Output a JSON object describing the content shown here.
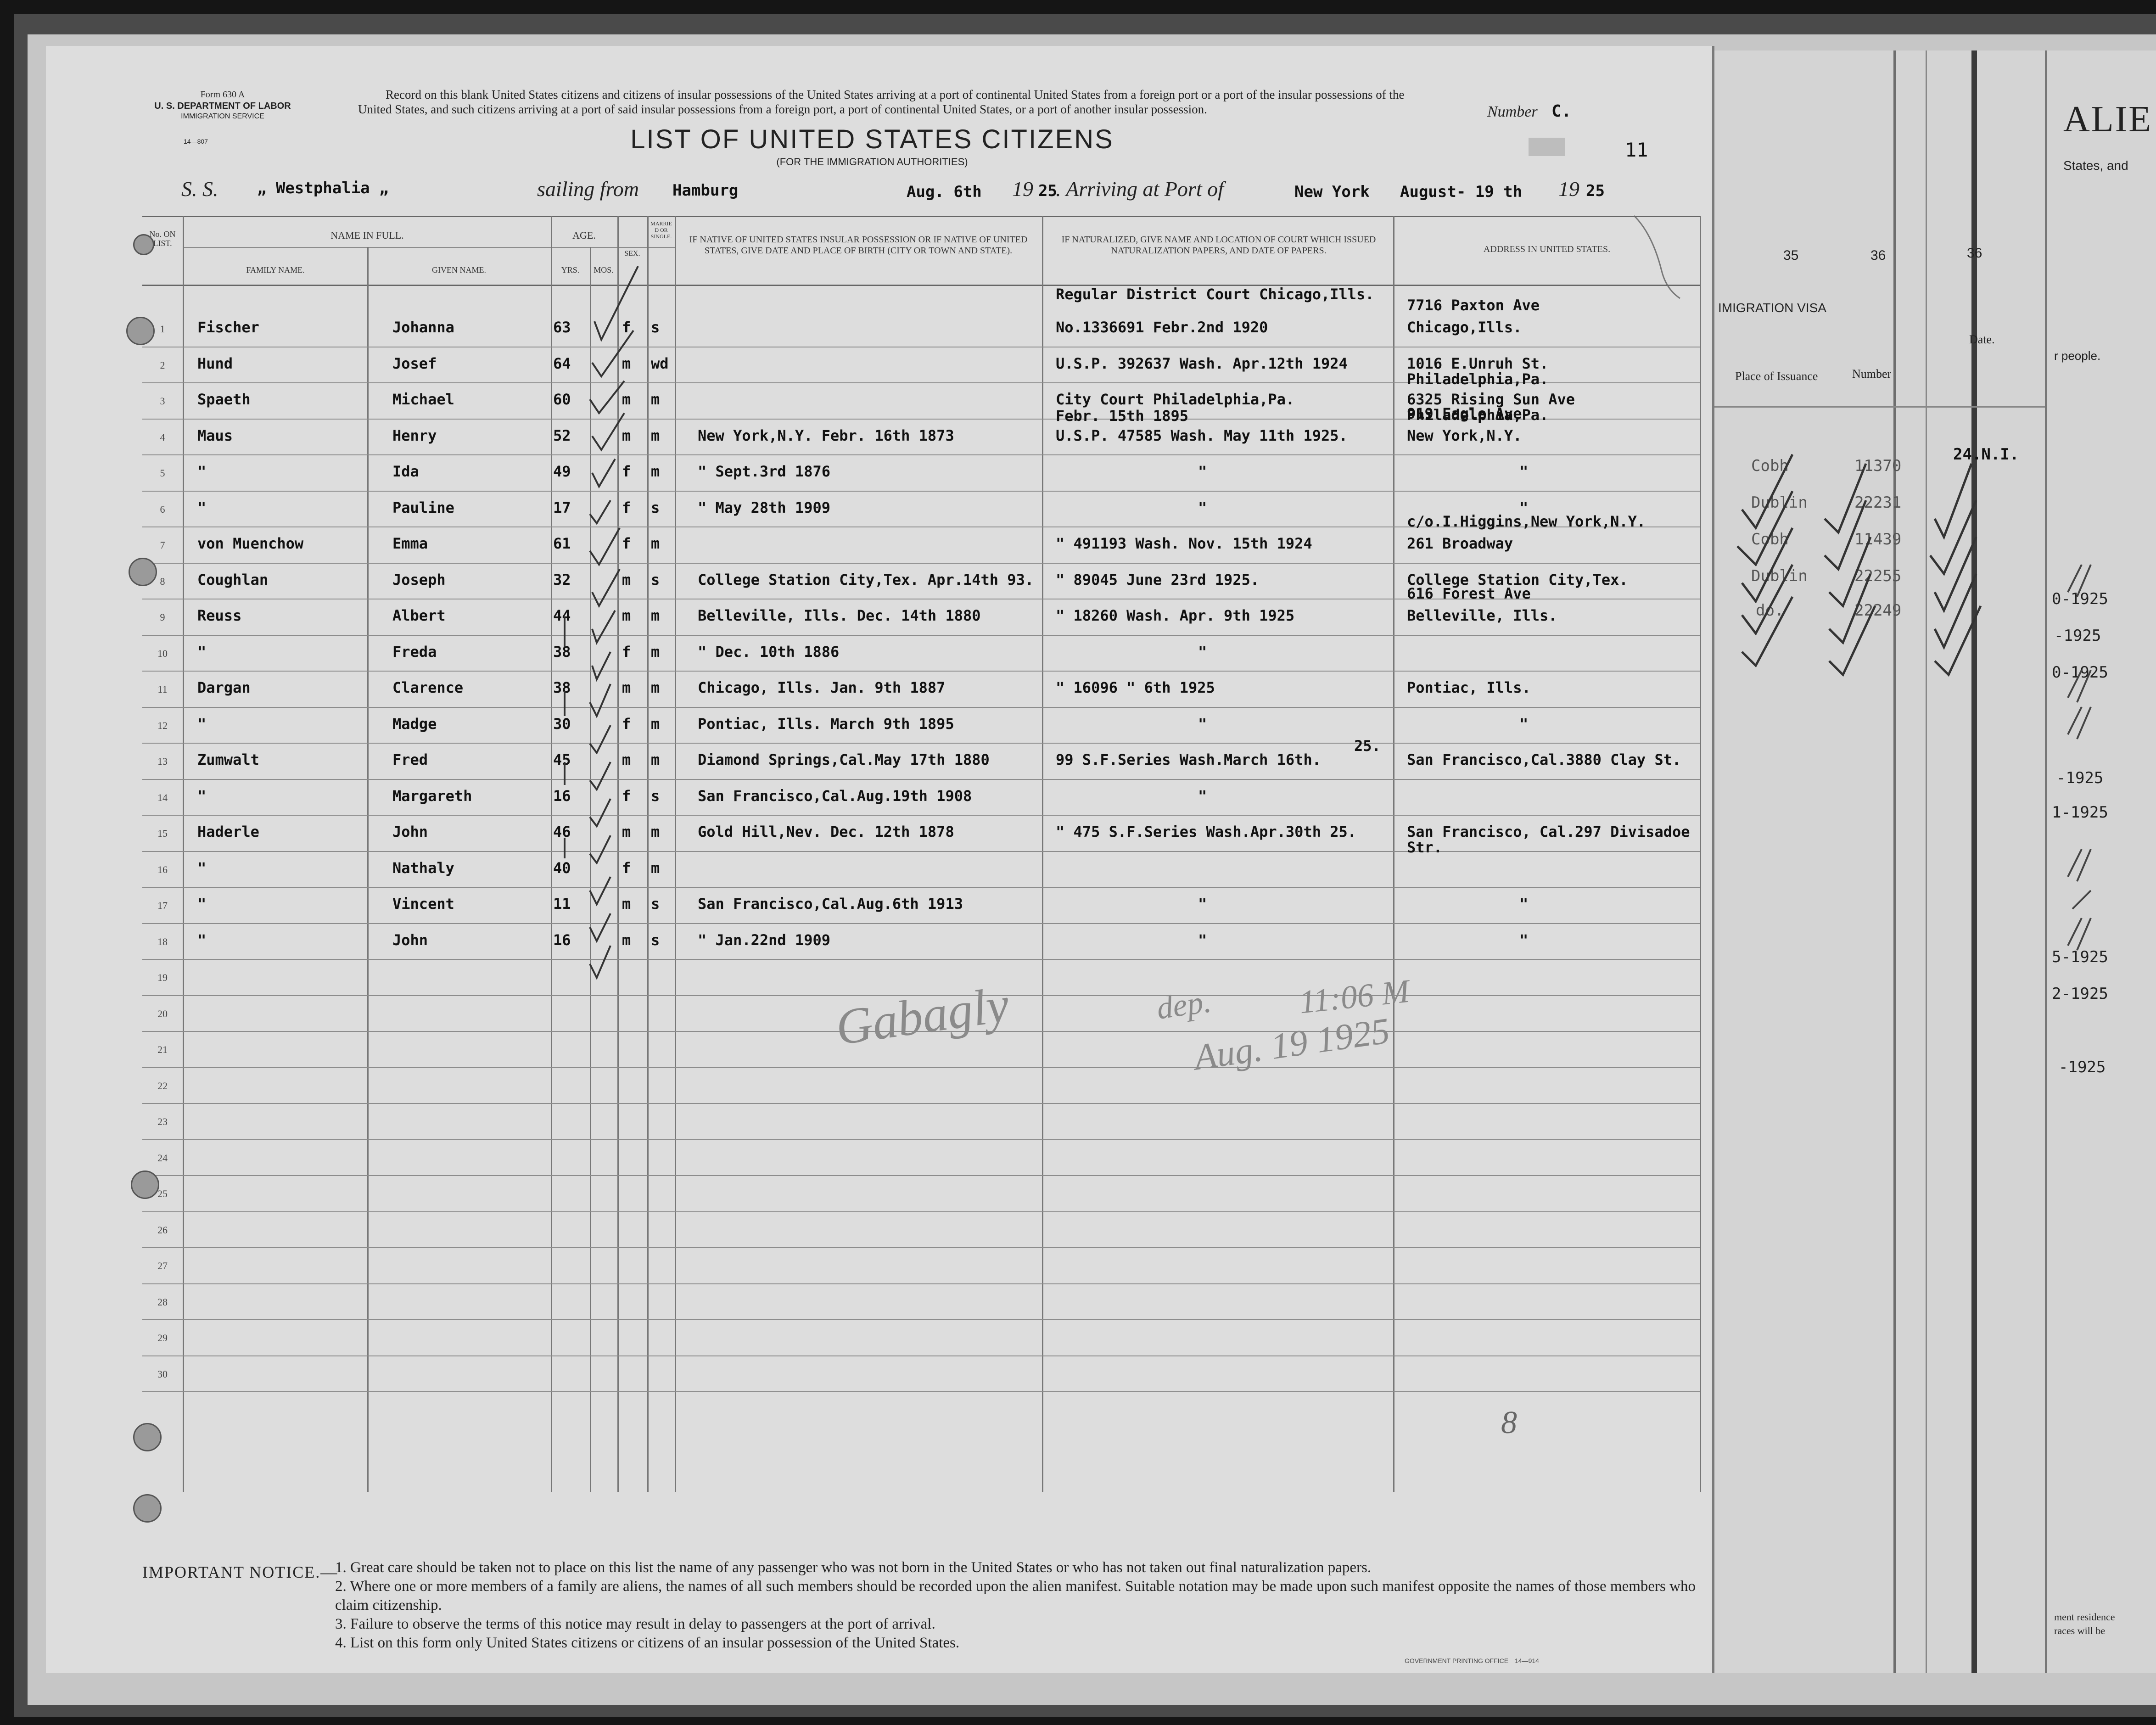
{
  "form": {
    "form_no": "Form 630 A",
    "department": "U. S. DEPARTMENT OF LABOR",
    "service": "IMMIGRATION SERVICE",
    "code": "14—807",
    "record_text": "Record on this blank United States citizens and citizens of insular possessions of the United States arriving at a port of continental United States from a foreign port or a port of the insular possessions of the United States, and such citizens arriving at a port of said insular possessions from a foreign port, a port of continental United States, or a port of another insular possession.",
    "title": "LIST OF UNITED STATES CITIZENS",
    "subtitle": "(FOR THE IMMIGRATION AUTHORITIES)",
    "number_label": "Number",
    "number_value": "C.",
    "sheet_number": "11",
    "ss_label": "S. S.",
    "ship": "„ Westphalia „",
    "sailing_label": "sailing from",
    "sailing_from": "Hamburg",
    "sail_date": "Aug. 6th",
    "year_prefix": "19",
    "sail_year": "25",
    "arriving_label": ". Arriving at Port of",
    "arrival_port": "New York",
    "arrival_date": "August- 19 th",
    "arrival_year": "25"
  },
  "columns": {
    "no": "No. ON LIST.",
    "name": "NAME IN FULL.",
    "family": "FAMILY NAME.",
    "given": "GIVEN NAME.",
    "age": "AGE.",
    "yrs": "YRS.",
    "mos": "MOS.",
    "sex": "SEX.",
    "married": "MARRIED OR SINGLE.",
    "native": "IF NATIVE OF UNITED STATES INSULAR POSSESSION OR IF NATIVE OF UNITED STATES, GIVE DATE AND PLACE OF BIRTH (CITY OR TOWN AND STATE).",
    "naturalized": "IF NATURALIZED, GIVE NAME AND LOCATION OF COURT WHICH ISSUED NATURALIZATION PAPERS, AND DATE OF PAPERS.",
    "address": "ADDRESS IN UNITED STATES."
  },
  "row_numbers": [
    "1",
    "2",
    "3",
    "4",
    "5",
    "6",
    "7",
    "8",
    "9",
    "10",
    "11",
    "12",
    "13",
    "14",
    "15",
    "16",
    "17",
    "18",
    "19",
    "20",
    "21",
    "22",
    "23",
    "24",
    "25",
    "26",
    "27",
    "28",
    "29",
    "30"
  ],
  "passengers": [
    {
      "family": "Fischer",
      "given": "Johanna",
      "age": "63",
      "sex": "f",
      "ms": "s",
      "birth": "",
      "nat": "No.1336691 Febr.2nd 1920",
      "nat_above": "Regular District Court Chicago,Ills.",
      "addr": "Chicago,Ills.",
      "addr_above": "7716 Paxton Ave"
    },
    {
      "family": "Hund",
      "given": "Josef",
      "age": "64",
      "sex": "m",
      "ms": "wd",
      "birth": "",
      "nat": "U.S.P. 392637 Wash. Apr.12th 1924",
      "nat_above": "",
      "addr": "1016 E.Unruh St.",
      "addr_below": "Philadelphia,Pa."
    },
    {
      "family": "Spaeth",
      "given": "Michael",
      "age": "60",
      "sex": "m",
      "ms": "m",
      "birth": "",
      "nat": "City Court Philadelphia,Pa.",
      "nat_below": "Febr. 15th 1895",
      "addr": "6325 Rising Sun Ave",
      "addr_below": "Philadelphia,Pa."
    },
    {
      "family": "Maus",
      "given": "Henry",
      "age": "52",
      "sex": "m",
      "ms": "m",
      "birth": "New York,N.Y. Febr. 16th 1873",
      "nat": "U.S.P. 47585 Wash. May 11th 1925.",
      "addr": "New York,N.Y.",
      "addr_above": "919 Eagle Ave"
    },
    {
      "family": "\"",
      "given": "Ida",
      "age": "49",
      "sex": "f",
      "ms": "m",
      "birth": "\"          Sept.3rd 1876",
      "nat": "\"",
      "addr": "\""
    },
    {
      "family": "\"",
      "given": "Pauline",
      "age": "17",
      "sex": "f",
      "ms": "s",
      "birth": "\"          May 28th 1909",
      "nat": "\"",
      "addr": "\""
    },
    {
      "family": "von Muenchow",
      "given": "Emma",
      "age": "61",
      "sex": "f",
      "ms": "m",
      "birth": "",
      "nat": "\"    491193 Wash. Nov. 15th 1924",
      "addr": "261 Broadway",
      "addr_above": "c/o.I.Higgins,New York,N.Y."
    },
    {
      "family": "Coughlan",
      "given": "Joseph",
      "age": "32",
      "sex": "m",
      "ms": "s",
      "birth": "College Station City,Tex. Apr.14th 93.",
      "nat": "\"    89045       June 23rd 1925.",
      "addr": "College Station City,Tex."
    },
    {
      "family": "Reuss",
      "given": "Albert",
      "age": "44",
      "sex": "m",
      "ms": "m",
      "birth": "Belleville, Ills. Dec. 14th 1880",
      "nat": "\"    18260 Wash. Apr. 9th 1925",
      "addr": "Belleville, Ills.",
      "addr_above": "616 Forest Ave"
    },
    {
      "family": "\"",
      "given": "Freda",
      "age": "38",
      "sex": "f",
      "ms": "m",
      "birth": "\"          Dec. 10th 1886",
      "nat": "\"",
      "addr": ""
    },
    {
      "family": "Dargan",
      "given": "Clarence",
      "age": "38",
      "sex": "m",
      "ms": "m",
      "birth": "Chicago, Ills. Jan. 9th 1887",
      "nat": "\"    16096    \"    6th 1925",
      "addr": "Pontiac, Ills."
    },
    {
      "family": "\"",
      "given": "Madge",
      "age": "30",
      "sex": "f",
      "ms": "m",
      "birth": "Pontiac, Ills. March 9th 1895",
      "nat": "\"",
      "addr": "\""
    },
    {
      "family": "Zumwalt",
      "given": "Fred",
      "age": "45",
      "sex": "m",
      "ms": "m",
      "birth": "Diamond Springs,Cal.May 17th 1880",
      "nat": "99 S.F.Series Wash.March 16th.",
      "nat_sup": "25.",
      "addr": "San Francisco,Cal.3880 Clay St."
    },
    {
      "family": "\"",
      "given": "Margareth",
      "age": "16",
      "sex": "f",
      "ms": "s",
      "birth": "San Francisco,Cal.Aug.19th 1908",
      "nat": "\"",
      "addr": ""
    },
    {
      "family": "Haderle",
      "given": "John",
      "age": "46",
      "sex": "m",
      "ms": "m",
      "birth": "Gold Hill,Nev. Dec. 12th 1878",
      "nat": "\"    475 S.F.Series Wash.Apr.30th 25.",
      "addr": "San Francisco, Cal.297 Divisadoe",
      "addr_below": "Str."
    },
    {
      "family": "\"",
      "given": "Nathaly",
      "age": "40",
      "sex": "f",
      "ms": "m",
      "birth": "",
      "nat": "",
      "addr": ""
    },
    {
      "family": "\"",
      "given": "Vincent",
      "age": "11",
      "sex": "m",
      "ms": "s",
      "birth": "San Francisco,Cal.Aug.6th 1913",
      "nat": "\"",
      "addr": "\""
    },
    {
      "family": "\"",
      "given": "John",
      "age": "16",
      "sex": "m",
      "ms": "s",
      "birth": "\"          Jan.22nd 1909",
      "nat": "\"",
      "addr": "\""
    }
  ],
  "handwriting": {
    "signature": "Gabagly",
    "note_a": "dep.",
    "note_b": "11:06 M",
    "date_note": "Aug. 19 1925",
    "margin_mark": "8"
  },
  "notice": {
    "title": "IMPORTANT NOTICE.—",
    "items": [
      "1. Great care should be taken not to place on this list the name of any passenger who was not born in the United States or who has not taken out final naturalization papers.",
      "2. Where one or more members of a family are aliens, the names of all such members should be recorded upon the alien manifest. Suitable notation may be made upon such manifest opposite the names of those members who claim citizenship.",
      "3. Failure to observe the terms of this notice may result in delay to passengers at the port of arrival.",
      "4. List on this form only United States citizens or citizens of an insular possession of the United States."
    ],
    "printer": "GOVERNMENT PRINTING OFFICE",
    "printer_code": "14—914"
  },
  "right_sheet": {
    "title_fragment": "ALIE",
    "subtitle_fragment": "States, and",
    "col_35": "35",
    "col_36a": "36",
    "col_36b": "36",
    "visa_label": "IMIGRATION VISA",
    "place_label": "Place of Issuance",
    "number_label": "Number",
    "date_label": "Date.",
    "people_fragment": "r people.",
    "entries": [
      "11370",
      "22231",
      "11439",
      "22255",
      "22249"
    ],
    "places": [
      "Cobh",
      "Dublin",
      "Cobh",
      "Dublin",
      "do."
    ],
    "stamp": "24.N.I.",
    "dates": [
      "0-1925",
      "-1925",
      "0-1925",
      "-1925",
      "1-1925",
      "5-1925",
      "2-1925",
      "-1925"
    ],
    "foot_a": "ment residence",
    "foot_b": "races will be"
  }
}
